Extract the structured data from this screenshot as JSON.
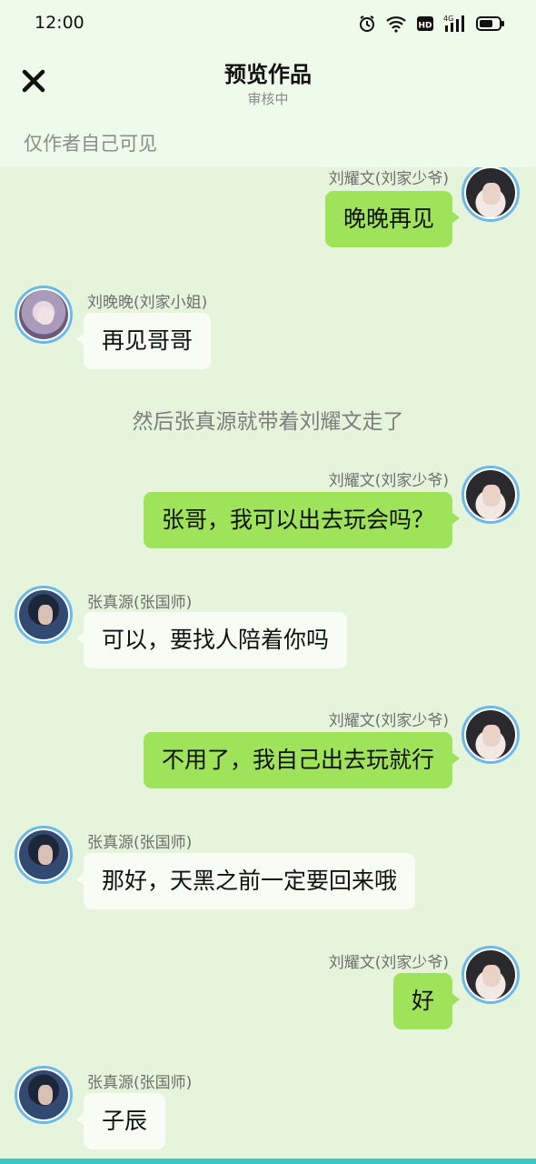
{
  "status_bar": {
    "time": "12:00",
    "network": "4G"
  },
  "header": {
    "title": "预览作品",
    "subtitle": "审核中",
    "visibility_note": "仅作者自己可见"
  },
  "messages": [
    {
      "side": "right",
      "sender": "刘耀文(刘家少爷)",
      "text": "晚晚再见",
      "avatar": "boy-avatar"
    },
    {
      "side": "left",
      "sender": "刘晚晚(刘家小姐)",
      "text": "再见哥哥",
      "avatar": "girl-avatar"
    },
    {
      "type": "narration",
      "text": "然后张真源就带着刘耀文走了"
    },
    {
      "side": "right",
      "sender": "刘耀文(刘家少爷)",
      "text": "张哥，我可以出去玩会吗？",
      "avatar": "boy-avatar"
    },
    {
      "side": "left",
      "sender": "张真源(张国师)",
      "text": "可以，要找人陪着你吗",
      "avatar": "man-avatar"
    },
    {
      "side": "right",
      "sender": "刘耀文(刘家少爷)",
      "text": "不用了，我自己出去玩就行",
      "avatar": "boy-avatar"
    },
    {
      "side": "left",
      "sender": "张真源(张国师)",
      "text": "那好，天黑之前一定要回来哦",
      "avatar": "man-avatar"
    },
    {
      "side": "right",
      "sender": "刘耀文(刘家少爷)",
      "text": "好",
      "avatar": "boy-avatar"
    },
    {
      "side": "left",
      "sender": "张真源(张国师)",
      "text": "子辰",
      "avatar": "man-avatar"
    }
  ],
  "colors": {
    "background": "#e6f4dc",
    "header_bg": "#eefbea",
    "right_bubble": "#9fe35b",
    "left_bubble": "#f8fcf5",
    "avatar_ring": "#6bb8ea"
  },
  "icons": [
    "alarm-icon",
    "wifi-icon",
    "hd-icon",
    "signal-icon",
    "battery-icon",
    "close-icon"
  ]
}
